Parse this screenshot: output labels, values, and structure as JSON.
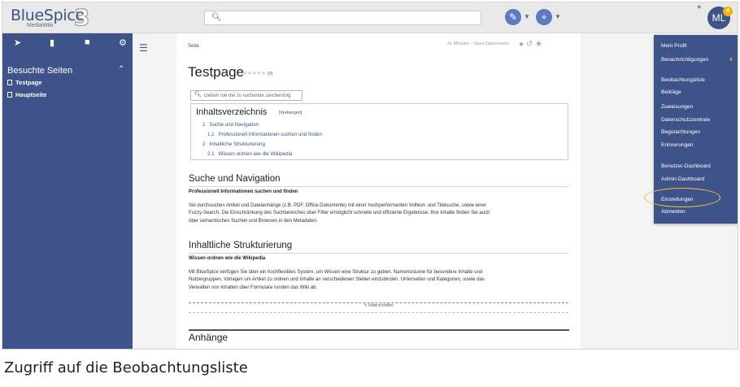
{
  "header": {
    "logo_text": "BlueSpice",
    "logo_sub": "MediaWiki",
    "logo_version": "3",
    "search_icon": "search-icon",
    "avatar_initials": "ML",
    "notification_count": "4"
  },
  "sidebar": {
    "tools": [
      "pin-icon",
      "book-icon",
      "clipboard-icon",
      "gear-icon"
    ],
    "section_title": "Besuchte Seiten",
    "items": [
      {
        "label": "Testpage"
      },
      {
        "label": "Hauptseite"
      }
    ],
    "background": "#3e5389"
  },
  "page": {
    "breadcrumb": "Seite",
    "meta": "41 Minuten - Sissy Oppermann",
    "title": "Testpage",
    "rating_stars": "★★★★★",
    "rating_count": "(0)",
    "search_placeholder": "Geben Sie die zu suchende Zeichenfolg",
    "toc": {
      "title": "Inhaltsverzeichnis",
      "toggle": "[Verbergen]",
      "entries": [
        {
          "num": "1",
          "label": "Suche und Navigation"
        },
        {
          "num": "1.1",
          "label": "Professionell Informationen suchen und finden"
        },
        {
          "num": "2",
          "label": "Inhaltliche Strukturierung"
        },
        {
          "num": "2.1",
          "label": "Wissen ordnen wie die Wikipedia"
        }
      ]
    },
    "sections": [
      {
        "heading": "Suche und Navigation",
        "subheading": "Professionell Informationen suchen und finden",
        "lines": [
          "Sie durchsuchen Artikel und Dateianhänge (z.B. PDF, Office-Dokumente) mit einer hochperformanten Volltext- und Titelsuche, sowie einer",
          "Fuzzy-Search. Die Einschränkung des Suchbereiches über Filter ermöglicht schnelle und effiziente Ergebnisse. Ihre Inhalte finden Sie auch",
          "über semantisches Suchen und Browsen in den Metadaten."
        ]
      },
      {
        "heading": "Inhaltliche Strukturierung",
        "subheading": "Wissen ordnen wie die Wikipedia",
        "lines": [
          "Mit BlueSpice verfügen Sie über ein hochflexibles System, um Wissen eine Struktur zu geben. Namensräume für besondere Inhalte und",
          "Nutzergruppen, Vorlagen um Artikel zu ordnen und Inhalte an verschiedenen Stellen einzubinden. Unterseiten und Kategorien, sowie das",
          "Verwalten von Inhalten über Formulare runden das Wiki ab."
        ]
      }
    ],
    "signature_label": "Unterschriften",
    "attachments_title": "Anhänge"
  },
  "user_menu": {
    "items": [
      "Mein Profil",
      "Benachrichtigungen",
      "Beobachtungsliste",
      "Beiträge",
      "Zuweisungen",
      "Datenschutzzentrale",
      "Begutachtungen",
      "Erinnerungen",
      "Benutzer-Dashboard",
      "Admin-Dashboard",
      "Einstellungen",
      "Abmelden"
    ],
    "notifications_count": "4",
    "highlight_color": "#f4c430"
  },
  "caption": "Zugriff auf die Beobachtungsliste"
}
